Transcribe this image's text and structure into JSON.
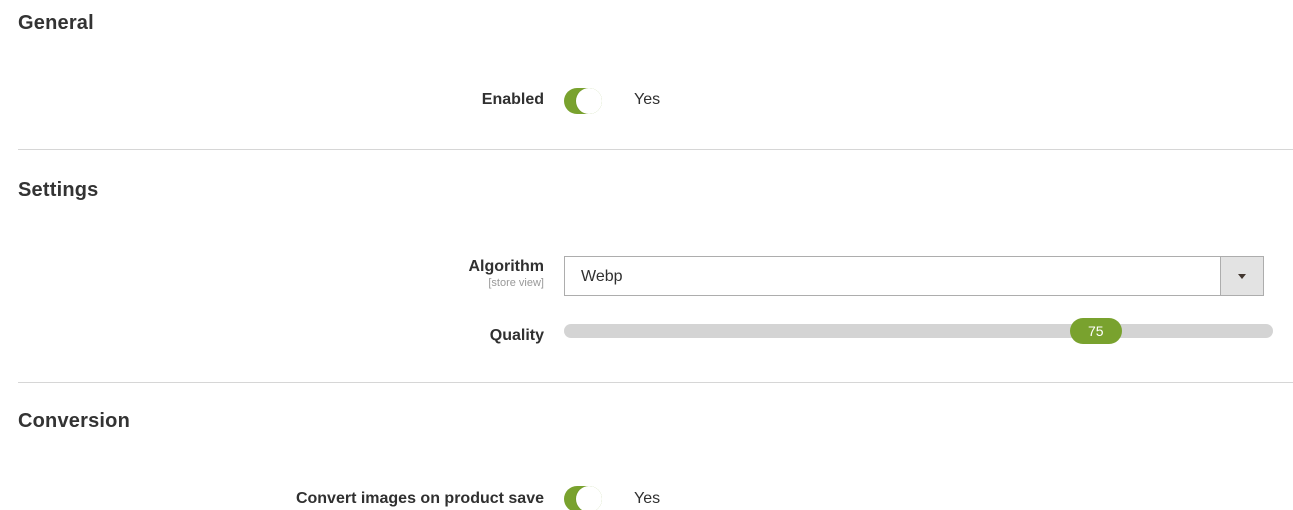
{
  "colors": {
    "accent": "#79a22e",
    "divider": "#d6d6d6",
    "slider_track": "#d4d4d4"
  },
  "sections": {
    "general": {
      "title": "General",
      "enabled": {
        "label": "Enabled",
        "value": "Yes",
        "on": true
      }
    },
    "settings": {
      "title": "Settings",
      "algorithm": {
        "label": "Algorithm",
        "scope": "[store view]",
        "selected": "Webp",
        "icon": "chevron-down-icon"
      },
      "quality": {
        "label": "Quality",
        "value": "75",
        "min": 0,
        "max": 100
      }
    },
    "conversion": {
      "title": "Conversion",
      "convert_on_save": {
        "label": "Convert images on product save",
        "value": "Yes",
        "on": true
      }
    }
  }
}
